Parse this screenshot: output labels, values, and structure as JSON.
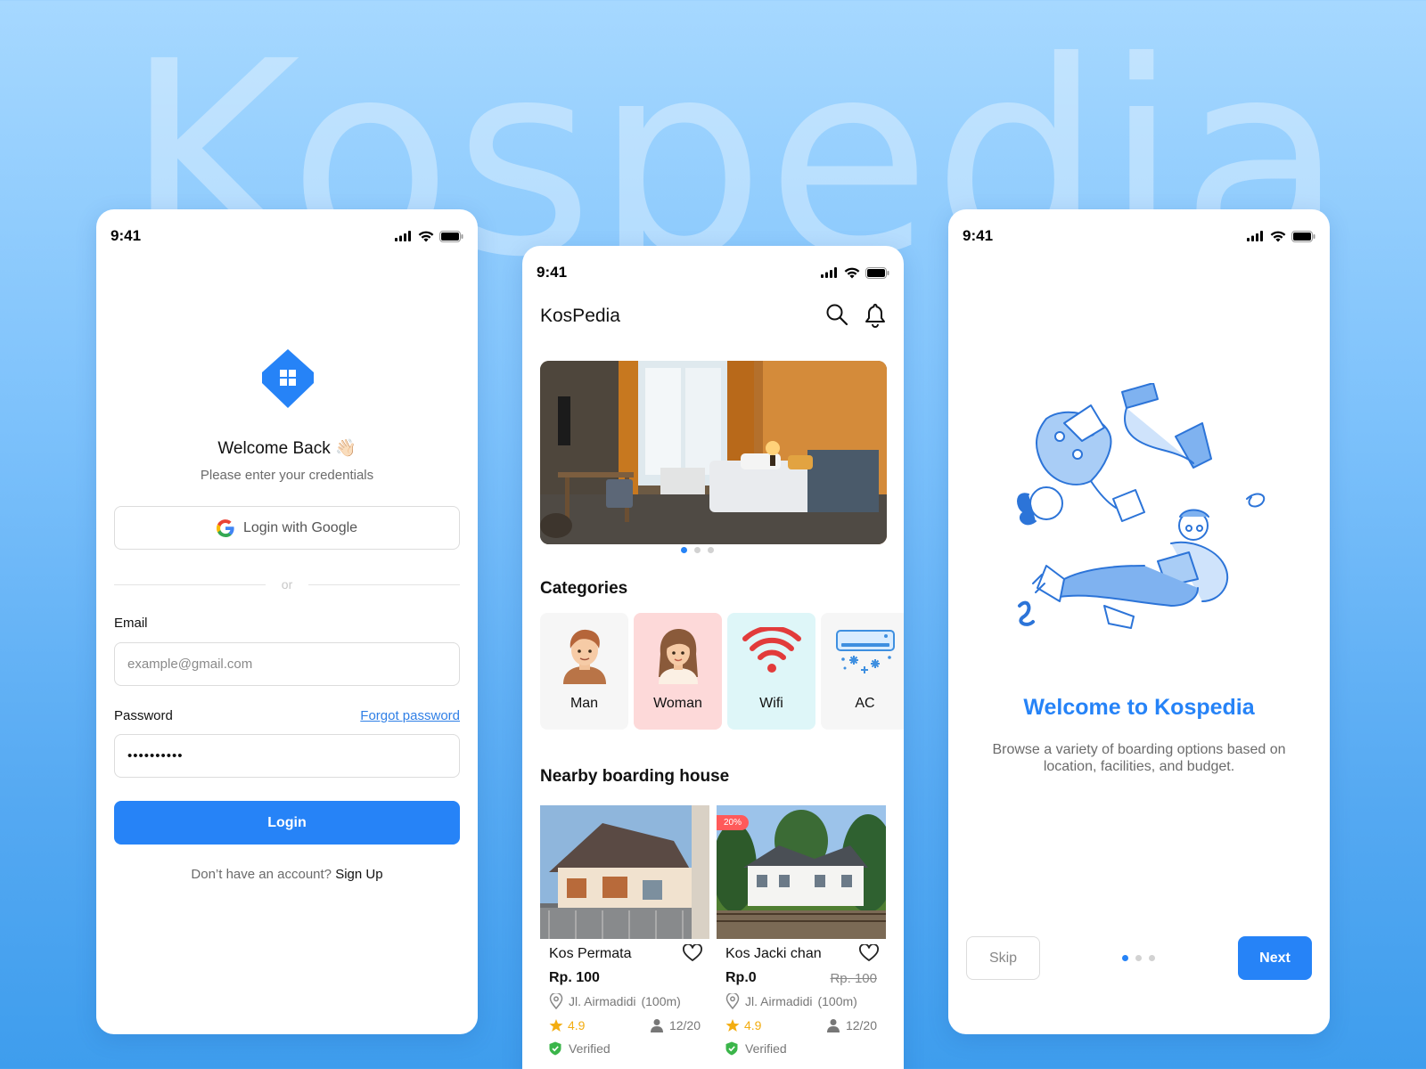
{
  "background": {
    "word": "Kospedia"
  },
  "status_bar": {
    "time": "9:41"
  },
  "login": {
    "welcome_title": "Welcome Back 👋🏻",
    "welcome_subtitle": "Please enter your credentials",
    "google_button": "Login with Google",
    "divider": "or",
    "email_label": "Email",
    "email_placeholder": "example@gmail.com",
    "password_label": "Password",
    "forgot_password": "Forgot password",
    "password_value": "••••••••••",
    "login_button": "Login",
    "no_account": "Don’t have an account?",
    "signup_link": "Sign Up"
  },
  "home": {
    "title": "KosPedia",
    "carousel_index": 1,
    "carousel_count": 3,
    "categories_title": "Categories",
    "categories": [
      {
        "label": "Man",
        "icon": "man-avatar-icon",
        "bg": "#f6f6f6"
      },
      {
        "label": "Woman",
        "icon": "woman-avatar-icon",
        "bg": "#fdd9d9"
      },
      {
        "label": "Wifi",
        "icon": "wifi-icon",
        "bg": "#def6f8"
      },
      {
        "label": "AC",
        "icon": "air-conditioner-icon",
        "bg": "#f6f6f6"
      }
    ],
    "nearby_title": "Nearby boarding house",
    "listings": [
      {
        "name": "Kos Permata",
        "price": "Rp. 100",
        "old_price": "",
        "discount": "",
        "address": "Jl. Airmadidi",
        "distance": "(100m)",
        "rating": "4.9",
        "occupancy": "12/20",
        "verified": "Verified"
      },
      {
        "name": "Kos Jacki chan",
        "price": "Rp.0",
        "old_price": "Rp. 100",
        "discount": "20%",
        "address": "Jl. Airmadidi",
        "distance": "(100m)",
        "rating": "4.9",
        "occupancy": "12/20",
        "verified": "Verified"
      }
    ]
  },
  "onboarding": {
    "title": "Welcome to Kospedia",
    "subtitle": "Browse a variety of boarding options based on location, facilities, and budget.",
    "skip_button": "Skip",
    "next_button": "Next",
    "page_index": 1,
    "page_count": 3
  },
  "colors": {
    "accent": "#2683f7",
    "discount_badge": "#ff5a5a",
    "rating_star": "#f3ad11",
    "verified": "#3bb54a"
  }
}
